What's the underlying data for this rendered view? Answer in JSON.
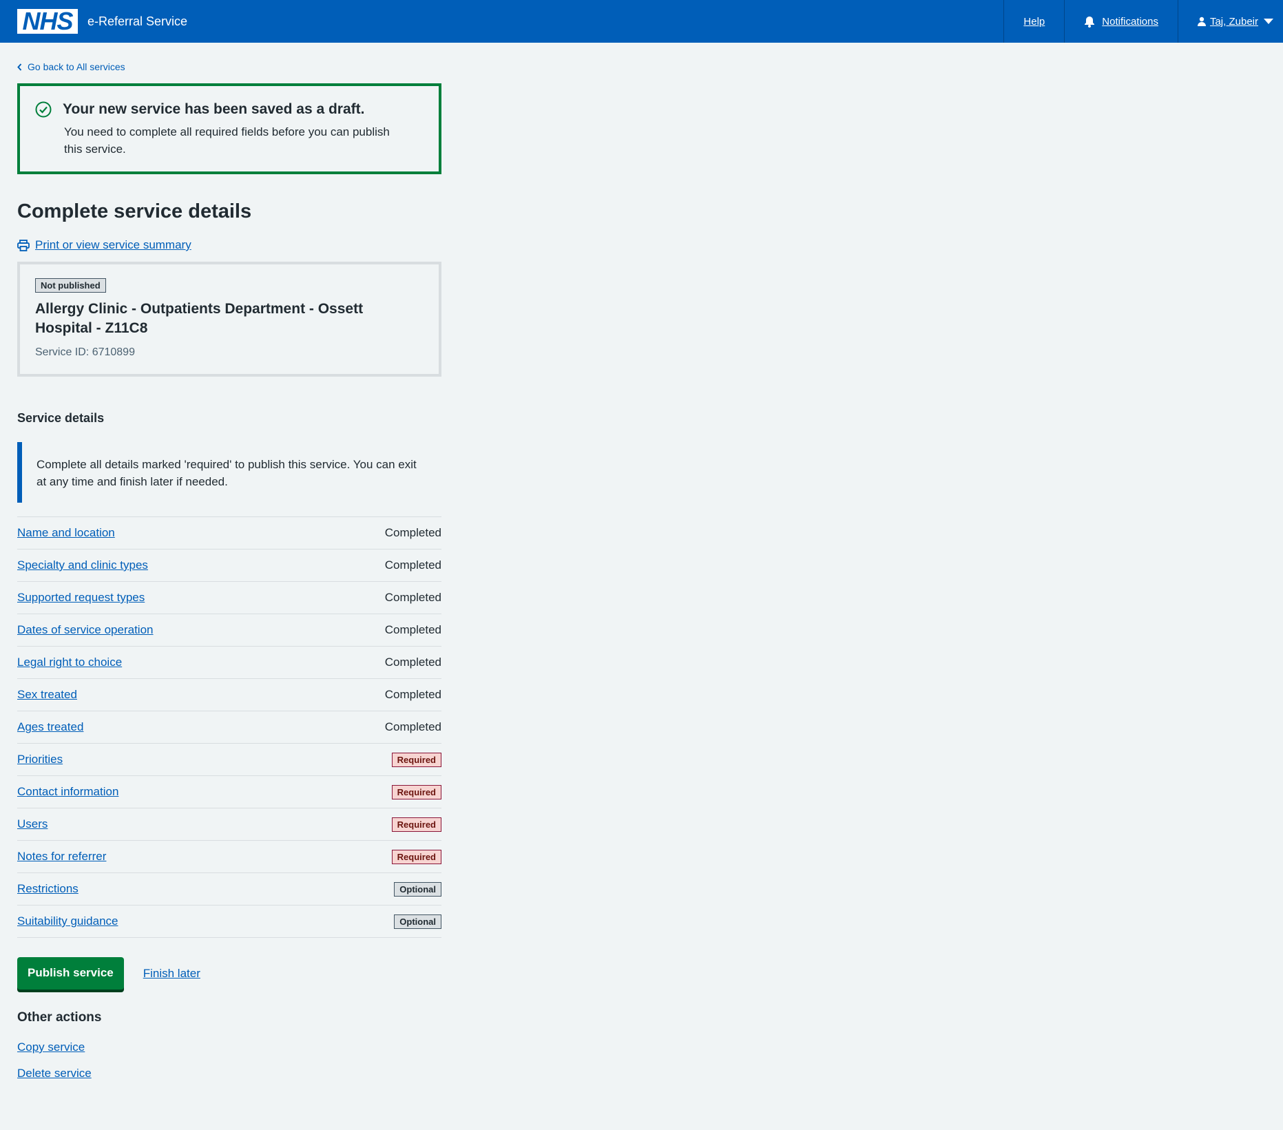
{
  "header": {
    "logo_text": "NHS",
    "service_name": "e-Referral Service",
    "help_label": "Help",
    "notifications_label": "Notifications",
    "user_label": "Taj, Zubeir",
    "brand_color": "#005eb8"
  },
  "back_link": "Go back to All services",
  "success": {
    "title": "Your new service has been saved as a draft.",
    "body": "You need to complete all required fields before you can publish this service.",
    "color": "#007f3b"
  },
  "page_title": "Complete service details",
  "print_link": "Print or view service summary",
  "summary": {
    "status_tag": "Not published",
    "title": "Allergy Clinic - Outpatients Department - Ossett Hospital - Z11C8",
    "service_id": "Service ID: 6710899"
  },
  "section_title": "Service details",
  "inset_text": "Complete all details marked 'required' to publish this service. You can exit at any time and finish later if needed.",
  "tasks": [
    {
      "label": "Name and location",
      "status": "Completed",
      "kind": "completed"
    },
    {
      "label": "Specialty and clinic types",
      "status": "Completed",
      "kind": "completed"
    },
    {
      "label": "Supported request types",
      "status": "Completed",
      "kind": "completed"
    },
    {
      "label": "Dates of service operation",
      "status": "Completed",
      "kind": "completed"
    },
    {
      "label": "Legal right to choice",
      "status": "Completed",
      "kind": "completed"
    },
    {
      "label": "Sex treated",
      "status": "Completed",
      "kind": "completed"
    },
    {
      "label": "Ages treated",
      "status": "Completed",
      "kind": "completed"
    },
    {
      "label": "Priorities",
      "status": "Required",
      "kind": "required"
    },
    {
      "label": "Contact information",
      "status": "Required",
      "kind": "required"
    },
    {
      "label": "Users",
      "status": "Required",
      "kind": "required"
    },
    {
      "label": "Notes for referrer",
      "status": "Required",
      "kind": "required"
    },
    {
      "label": "Restrictions",
      "status": "Optional",
      "kind": "optional"
    },
    {
      "label": "Suitability guidance",
      "status": "Optional",
      "kind": "optional"
    }
  ],
  "actions": {
    "publish_label": "Publish service",
    "finish_later_label": "Finish later"
  },
  "other_actions": {
    "title": "Other actions",
    "copy_label": "Copy service",
    "delete_label": "Delete service"
  }
}
